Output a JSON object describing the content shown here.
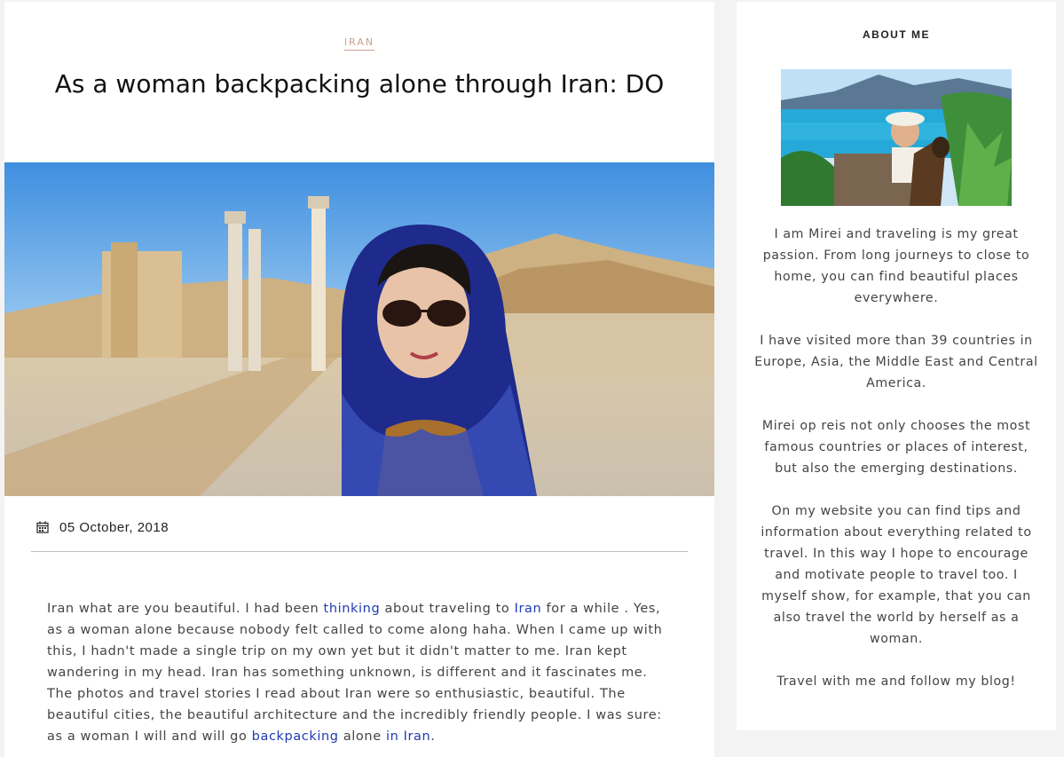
{
  "post": {
    "category": "IRAN",
    "title": "As a woman backpacking alone through Iran: DO",
    "date": "05 October, 2018",
    "body": {
      "t1": "Iran what are you beautiful. I had been ",
      "l1": "thinking",
      "t2": " about traveling to ",
      "l2": "Iran",
      "t3": " for a while . Yes, as a woman alone because nobody felt called to come along haha. When I came up with this, I hadn't made a single trip on my own yet but it didn't matter to me. Iran kept wandering in my head. Iran has something unknown, is different and it fascinates me. The photos and travel stories I read about Iran were so enthusiastic, beautiful. The beautiful cities, the beautiful architecture and the incredibly friendly people. I was sure: as a woman I will and will go ",
      "l3": "backpacking",
      "t4": " alone ",
      "l4": "in Iran",
      "t5": "."
    }
  },
  "sidebar": {
    "widget_title": "ABOUT ME",
    "paragraphs": [
      "I am Mirei and traveling is my great passion. From long journeys to close to home, you can find beautiful places everywhere.",
      "I have visited more than 39 countries in Europe, Asia, the Middle East and Central America.",
      "Mirei op reis not only chooses the most famous countries or places of interest, but also the emerging destinations.",
      "On my website you can find tips and information about everything related to travel. In this way I hope to encourage and motivate people to travel too. I myself show, for example, that you can also travel the world by herself as a woman.",
      "Travel with me and follow my blog!"
    ]
  },
  "icons": {
    "date": "calendar-icon"
  },
  "colors": {
    "category": "#c9a28f",
    "link": "#1f3bb3",
    "background": "#f3f3f3"
  }
}
